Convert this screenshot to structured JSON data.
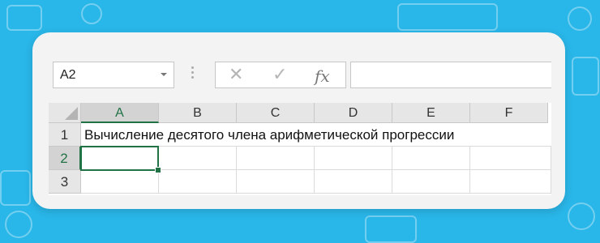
{
  "colors": {
    "background": "#29b6e8",
    "accent": "#217346"
  },
  "formula_bar": {
    "name_box_value": "A2",
    "cancel_icon": "✕",
    "enter_icon": "✓",
    "fx_label": "fx",
    "formula_value": ""
  },
  "columns": [
    "A",
    "B",
    "C",
    "D",
    "E",
    "F"
  ],
  "rows": [
    "1",
    "2",
    "3"
  ],
  "cells": {
    "A1": "Вычисление десятого  члена арифметической прогрессии"
  },
  "selected_cell": "A2"
}
